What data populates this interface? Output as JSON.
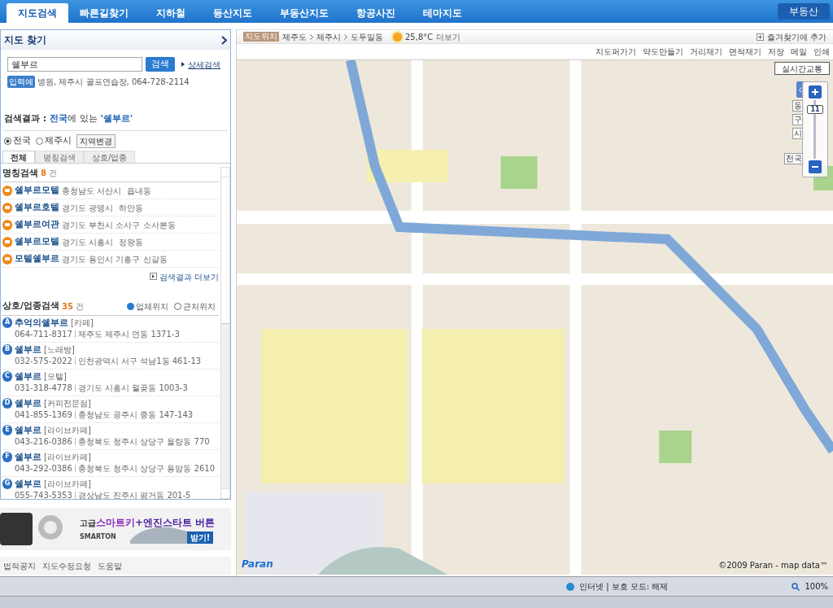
{
  "nav": {
    "tabs": [
      {
        "label": "지도검색",
        "selected": true
      },
      {
        "label": "빠른길찾기",
        "selected": false
      },
      {
        "label": "지하철",
        "selected": false
      },
      {
        "label": "등산지도",
        "selected": false
      },
      {
        "label": "부동산지도",
        "selected": false
      },
      {
        "label": "항공사진",
        "selected": false
      },
      {
        "label": "테마지도",
        "selected": false
      }
    ],
    "right_button": "부동산"
  },
  "sidebar": {
    "title": "지도 찾기",
    "search": {
      "value": "쉘부르",
      "button": "검색",
      "link": "상세검색"
    },
    "example": {
      "badge": "입력예",
      "text": "병원, 제주시 골프연습장, 064-728-2114"
    },
    "result_heading": {
      "label": "검색결과 :",
      "scope": "전국",
      "middle": "에 있는",
      "query": "'쉘부르'"
    },
    "regions": [
      {
        "label": "전국",
        "selected": true
      },
      {
        "label": "제주시",
        "selected": false
      }
    ],
    "region_button": "지역변경",
    "result_tabs": [
      {
        "label": "전체",
        "selected": true
      },
      {
        "label": "명칭검색",
        "selected": false
      },
      {
        "label": "상호/업종",
        "selected": false
      }
    ],
    "name_search": {
      "title": "명칭검색",
      "count": "8",
      "unit": "건",
      "more": "검색결과 더보기",
      "items": [
        {
          "name": "쉘부르모텔",
          "address": "충청남도 서산시  읍내동"
        },
        {
          "name": "쉘부르호텔",
          "address": "경기도 광명시  하안동"
        },
        {
          "name": "쉘부르여관",
          "address": "경기도 부천시 소사구 소사본동"
        },
        {
          "name": "쉘부르모텔",
          "address": "경기도 시흥시  정왕동"
        },
        {
          "name": "모텔쉘부르",
          "address": "경기도 용인시 기흥구 신갈동"
        }
      ]
    },
    "biz_search": {
      "title": "상호/업종검색",
      "count": "35",
      "unit": "건",
      "legends": [
        "업체위치",
        "근처위치"
      ],
      "items": [
        {
          "marker": "A",
          "name": "추억의쉘부르",
          "category": "[카페]",
          "phone": "064-711-8317",
          "address": "제주도 제주시 연동 1371-3"
        },
        {
          "marker": "B",
          "name": "쉘부르",
          "category": "[노래방]",
          "phone": "032-575-2022",
          "address": "인천광역시 서구 석남1동 461-13"
        },
        {
          "marker": "C",
          "name": "쉘부르",
          "category": "[모텔]",
          "phone": "031-318-4778",
          "address": "경기도 시흥시 월곶동 1003-3"
        },
        {
          "marker": "D",
          "name": "쉘부르",
          "category": "[커피전문점]",
          "phone": "041-855-1369",
          "address": "충청남도 공주시 중동 147-143"
        },
        {
          "marker": "E",
          "name": "쉘부르",
          "category": "[라이브카페]",
          "phone": "043-216-0386",
          "address": "충청북도 청주시 상당구 율량동 770"
        },
        {
          "marker": "F",
          "name": "쉘부르",
          "category": "[라이브카페]",
          "phone": "043-292-0386",
          "address": "충청북도 청주시 상당구 용암동 2610"
        },
        {
          "marker": "G",
          "name": "쉘부르",
          "category": "[라이브카페]",
          "phone": "055-743-5353",
          "address": "경상남도 진주시 평거동 201-5"
        }
      ]
    },
    "ad": {
      "prefix": "고급",
      "highlight": "스마트키",
      "rest": "+엔진스타트 버튼",
      "brand": "SMARTON",
      "action": "받기!"
    },
    "footer_links": [
      "법적공지",
      "지도수정요청",
      "도움말"
    ]
  },
  "map": {
    "breadcrumb": {
      "badge": "지도위치",
      "path": [
        "제주도",
        "제주시",
        "도두일동"
      ],
      "weather": "25,8°C",
      "more": "더보기"
    },
    "favorite": "즐겨찾기에 추가",
    "tools": [
      "지도퍼가기",
      "약도만들기",
      "거리재기",
      "면적재기",
      "저장",
      "메일",
      "인쇄"
    ],
    "traffic_button": "실시간교통",
    "zoom": {
      "level": 0.9,
      "level_label": "11",
      "scales": [
        "동",
        "구",
        "시",
        "전국"
      ]
    },
    "logo": "Paran",
    "copyright": "©2009 Paran - map data™"
  },
  "status_bar": {
    "zone": "인터넷 | 보호 모드: 해제",
    "zoom": "100%"
  }
}
